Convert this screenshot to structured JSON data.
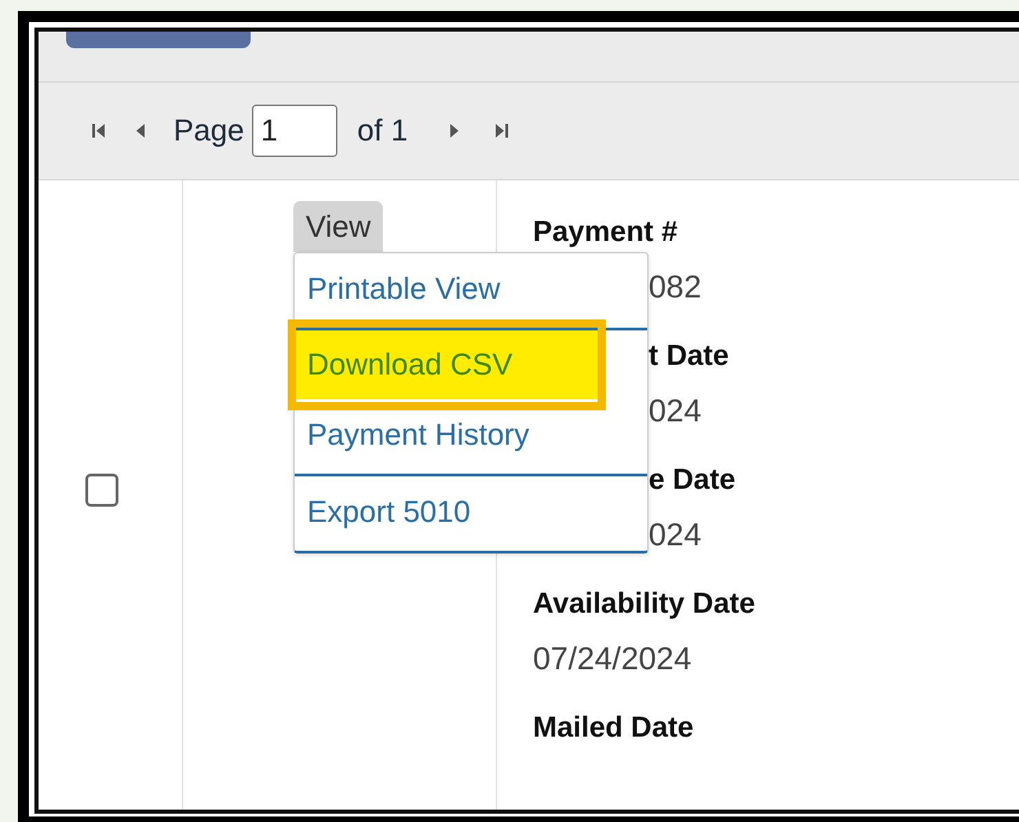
{
  "pager": {
    "label": "Page",
    "page": "1",
    "of_label": "of 1"
  },
  "row": {
    "checked": false,
    "view_button": "View",
    "menu": [
      {
        "label": "Printable View",
        "highlighted": false
      },
      {
        "label": "Download CSV",
        "highlighted": true
      },
      {
        "label": "Payment History",
        "highlighted": false
      },
      {
        "label": "Export 5010",
        "highlighted": false
      }
    ],
    "fields": [
      {
        "label": "Payment #",
        "value": "082",
        "value_covered": true
      },
      {
        "label": "t Date",
        "value": "024",
        "label_covered": true,
        "value_covered": true
      },
      {
        "label": "e Date",
        "value": "024",
        "label_covered": true,
        "value_covered": true
      },
      {
        "label": "Availability Date",
        "value": "07/24/2024"
      },
      {
        "label": "Mailed Date"
      }
    ]
  }
}
